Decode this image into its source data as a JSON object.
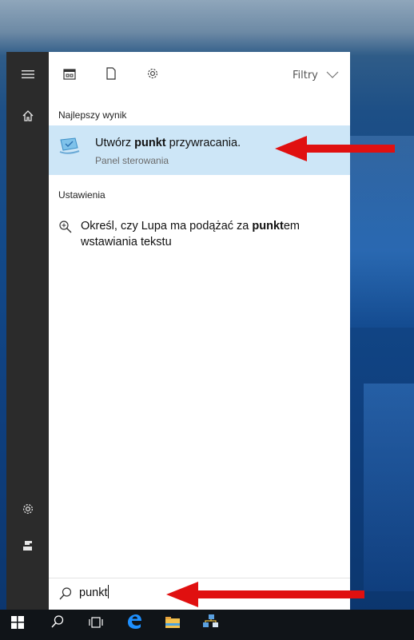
{
  "toolbar": {
    "filters_label": "Filtry"
  },
  "sections": {
    "best_match_label": "Najlepszy wynik",
    "settings_label": "Ustawienia"
  },
  "best_match": {
    "title_prefix": "Utwórz ",
    "title_bold": "punkt",
    "title_suffix": " przywracania.",
    "subtitle": "Panel sterowania"
  },
  "settings_result": {
    "text_prefix": "Określ, czy Lupa ma podążać za ",
    "text_bold": "punkt",
    "text_suffix": "em wstawiania tekstu"
  },
  "search": {
    "value": "punkt"
  },
  "icons": {
    "hamburger": "hamburger-icon",
    "home": "home-icon",
    "settings": "gear-icon",
    "user": "user-icon",
    "apps": "apps-icon",
    "documents": "document-icon",
    "web": "gear-icon",
    "magnifier": "magnifier-icon",
    "search": "search-icon"
  },
  "colors": {
    "selection": "#cde6f7",
    "rail": "#2b2b2b",
    "taskbar": "#101418",
    "annotation_arrow": "#e01010"
  }
}
